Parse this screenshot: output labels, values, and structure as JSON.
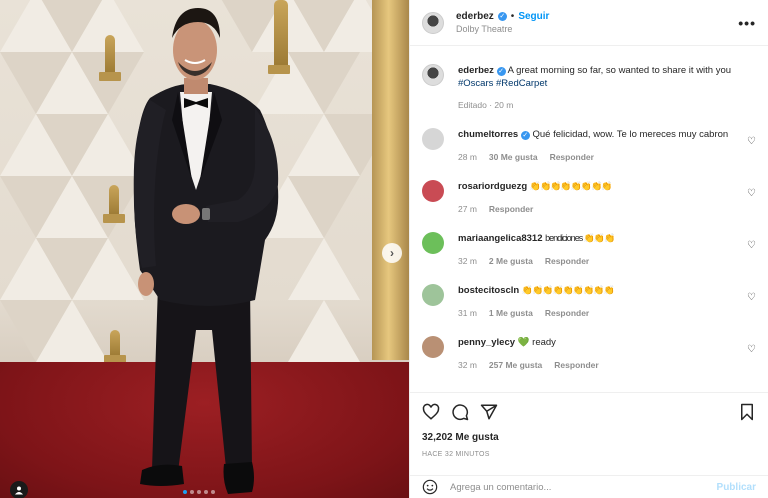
{
  "post": {
    "author": "ederbez",
    "follow_label": "Seguir",
    "location": "Dolby Theatre",
    "more_label": "•••",
    "caption": {
      "user": "ederbez",
      "text": "A great morning so far, so wanted to share it with you",
      "hashtag1": "#Oscars",
      "hashtag2": "#RedCarpet",
      "edited": "Editado · 20 m"
    },
    "likes": "32,202 Me gusta",
    "time_ago": "HACE 32 MINUTOS"
  },
  "comments": [
    {
      "user": "chumeltorres",
      "verified": true,
      "text": "Qué felicidad, wow. Te lo mereces muy cabron",
      "time": "28 m",
      "likes": "30 Me gusta",
      "reply": "Responder",
      "avatar_color": "#d6d6d6"
    },
    {
      "user": "rosariordguezg",
      "verified": false,
      "text": "👏👏👏👏👏👏👏👏",
      "time": "27 m",
      "likes": "",
      "reply": "Responder",
      "avatar_color": "#c94b54"
    },
    {
      "user": "mariaangelica8312",
      "verified": false,
      "text": "bendiciones 👏👏👏",
      "time": "32 m",
      "likes": "2 Me gusta",
      "reply": "Responder",
      "avatar_color": "#6cbf5a"
    },
    {
      "user": "bostecitoscln",
      "verified": false,
      "text": "👏👏👏👏👏👏👏👏👏",
      "time": "31 m",
      "likes": "1 Me gusta",
      "reply": "Responder",
      "avatar_color": "#9ec49a"
    },
    {
      "user": "penny_ylecy",
      "verified": false,
      "text": "💚 ready",
      "time": "32 m",
      "likes": "257 Me gusta",
      "reply": "Responder",
      "avatar_color": "#b99074"
    }
  ],
  "add_comment": {
    "placeholder": "Agrega un comentario...",
    "publish_label": "Publicar"
  },
  "colors": {
    "accent": "#0095f6",
    "verified": "#3897f0",
    "carpet": "#7e1418"
  },
  "icons": [
    "heart-icon",
    "comment-icon",
    "share-icon",
    "bookmark-icon",
    "emoji-icon",
    "tag-user-icon",
    "next-arrow-icon"
  ]
}
